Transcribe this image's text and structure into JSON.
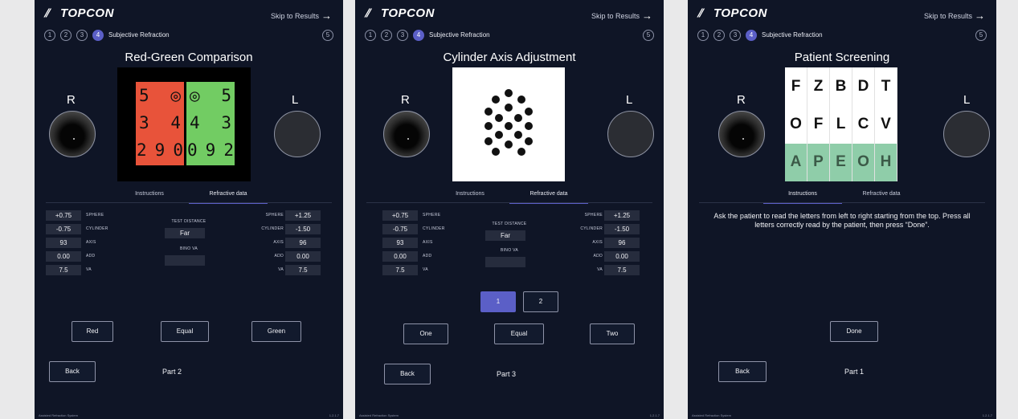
{
  "common": {
    "brand": "TOPCON",
    "skip": "Skip to Results",
    "steps": [
      "1",
      "2",
      "3",
      "4",
      "5"
    ],
    "active_step_label": "Subjective Refraction",
    "eye_right": "R",
    "eye_left": "L",
    "tab_instructions": "Instructions",
    "tab_refractive": "Refractive data",
    "back": "Back",
    "footer": "Assisted Refraction System",
    "version": "1.2.1.7",
    "accent_color": "#5b5fc7"
  },
  "refractive": {
    "right": [
      {
        "label": "SPHERE",
        "value": "+0.75"
      },
      {
        "label": "CYLINDER",
        "value": "-0.75"
      },
      {
        "label": "AXIS",
        "value": "93"
      },
      {
        "label": "ADD",
        "value": "0.00"
      },
      {
        "label": "VA",
        "value": "7.5"
      }
    ],
    "left": [
      {
        "label": "SPHERE",
        "value": "+1.25"
      },
      {
        "label": "CYLINDER",
        "value": "-1.50"
      },
      {
        "label": "AXIS",
        "value": "96"
      },
      {
        "label": "ADD",
        "value": "0.00"
      },
      {
        "label": "VA",
        "value": "7.5"
      }
    ],
    "test_distance_label": "TEST DISTANCE",
    "test_distance": "Far",
    "bino_va_label": "BINO VA",
    "bino_va": ""
  },
  "panel1": {
    "title": "Red-Green Comparison",
    "red_rows": [
      [
        "5",
        "◎"
      ],
      [
        "3",
        "4"
      ],
      [
        "2",
        "9",
        "0"
      ]
    ],
    "green_rows": [
      [
        "◎",
        "5"
      ],
      [
        "4",
        "3"
      ],
      [
        "0",
        "9",
        "2"
      ]
    ],
    "btn_red": "Red",
    "btn_equal": "Equal",
    "btn_green": "Green",
    "part": "Part 2"
  },
  "panel2": {
    "title": "Cylinder Axis Adjustment",
    "choice_1": "1",
    "choice_2": "2",
    "btn_one": "One",
    "btn_equal": "Equal",
    "btn_two": "Two",
    "part": "Part 3"
  },
  "panel3": {
    "title": "Patient Screening",
    "letters": [
      "F",
      "Z",
      "B",
      "D",
      "T",
      "O",
      "F",
      "L",
      "C",
      "V",
      "A",
      "P",
      "E",
      "O",
      "H"
    ],
    "instruction": "Ask the patient to read the letters from left to right starting from the top. Press all letters correctly read by the patient, then press “Done”.",
    "btn_done": "Done",
    "part": "Part 1"
  }
}
